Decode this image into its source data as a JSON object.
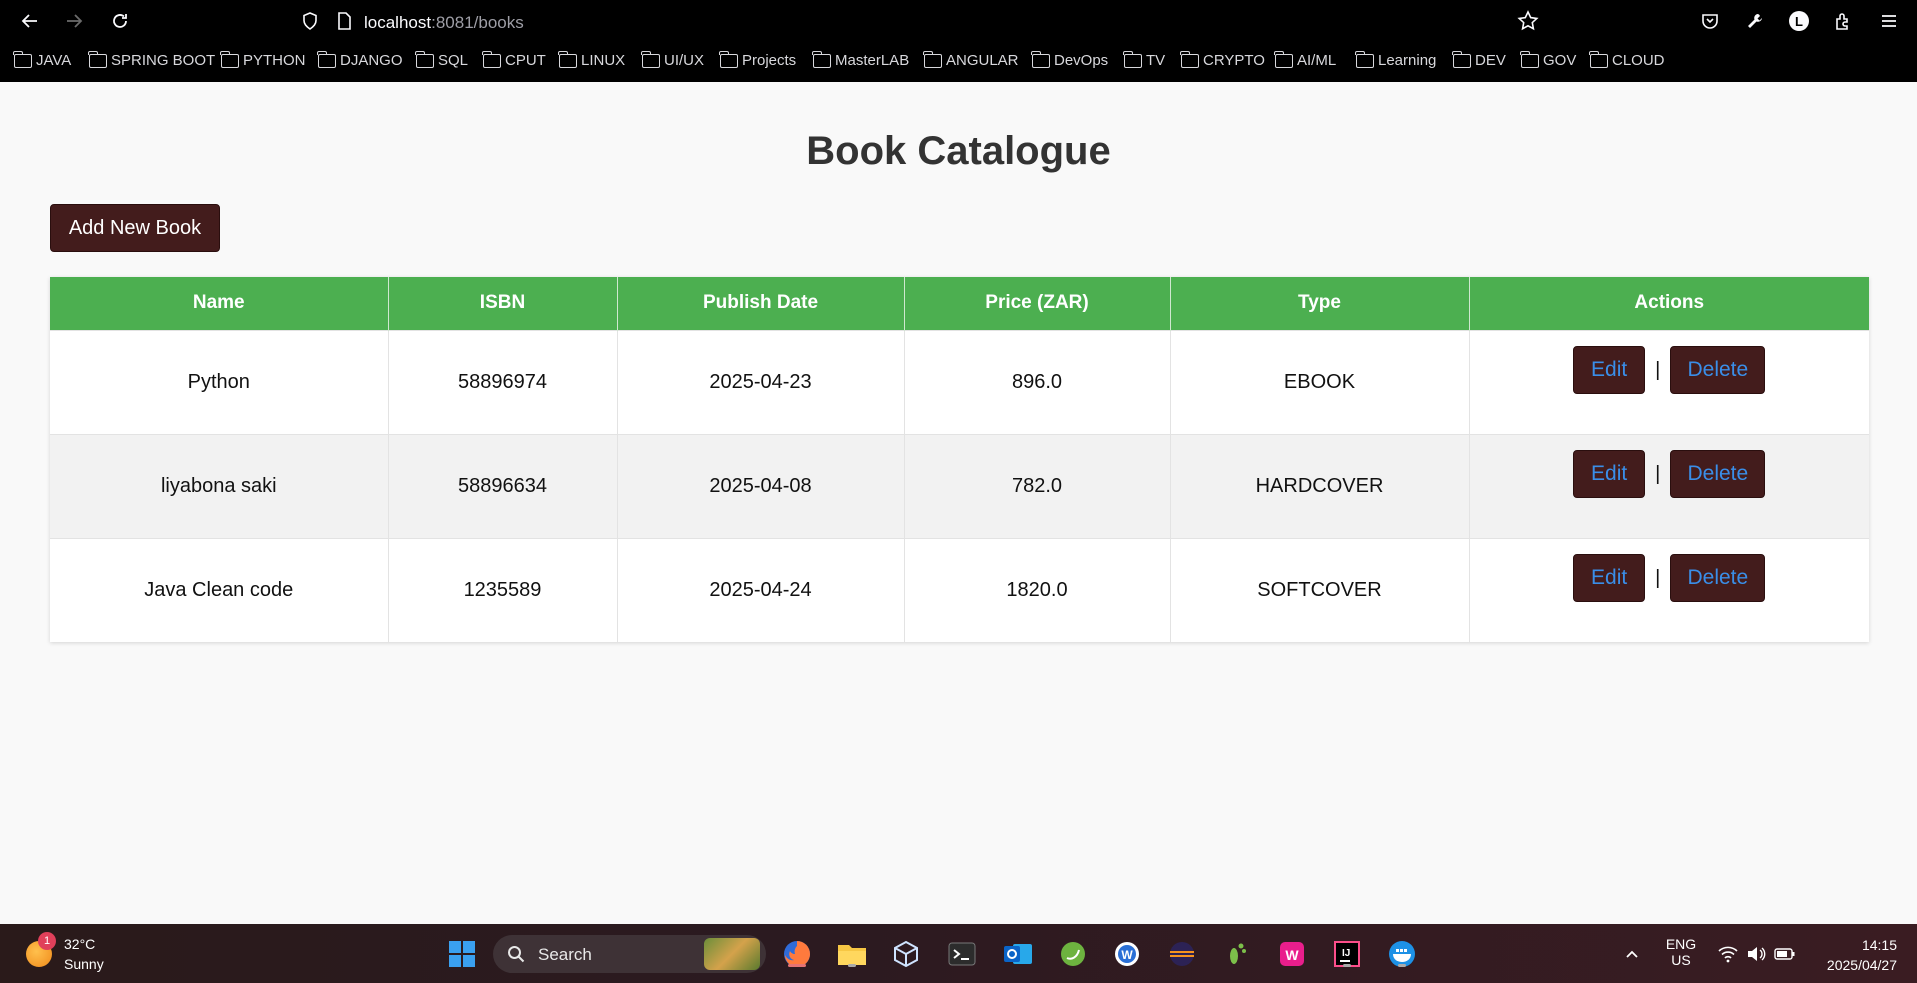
{
  "browser": {
    "url_host": "localhost",
    "url_path": ":8081/books",
    "bookmarks": [
      "JAVA",
      "SPRING BOOT",
      "PYTHON",
      "DJANGO",
      "SQL",
      "CPUT",
      "LINUX",
      "UI/UX",
      "Projects",
      "MasterLAB",
      "ANGULAR",
      "DevOps",
      "TV",
      "CRYPTO",
      "AI/ML",
      "Learning",
      "DEV",
      "GOV",
      "CLOUD"
    ],
    "profile_initial": "L"
  },
  "page": {
    "title": "Book Catalogue",
    "add_button": "Add New Book"
  },
  "table": {
    "headers": [
      "Name",
      "ISBN",
      "Publish Date",
      "Price (ZAR)",
      "Type",
      "Actions"
    ],
    "rows": [
      {
        "name": "Python",
        "isbn": "58896974",
        "publish_date": "2025-04-23",
        "price": "896.0",
        "type": "EBOOK"
      },
      {
        "name": "liyabona saki",
        "isbn": "58896634",
        "publish_date": "2025-04-08",
        "price": "782.0",
        "type": "HARDCOVER"
      },
      {
        "name": "Java Clean code",
        "isbn": "1235589",
        "publish_date": "2025-04-24",
        "price": "1820.0",
        "type": "SOFTCOVER"
      }
    ],
    "edit_label": "Edit",
    "delete_label": "Delete",
    "separator": "|"
  },
  "taskbar": {
    "weather_temp": "32°C",
    "weather_condition": "Sunny",
    "weather_badge": "1",
    "search_label": "Search",
    "language": "ENG",
    "region": "US",
    "time": "14:15",
    "date": "2025/04/27"
  },
  "colors": {
    "header_green": "#4caf50",
    "button_maroon": "#431c1c",
    "button_text_blue": "#3a8ee8"
  }
}
